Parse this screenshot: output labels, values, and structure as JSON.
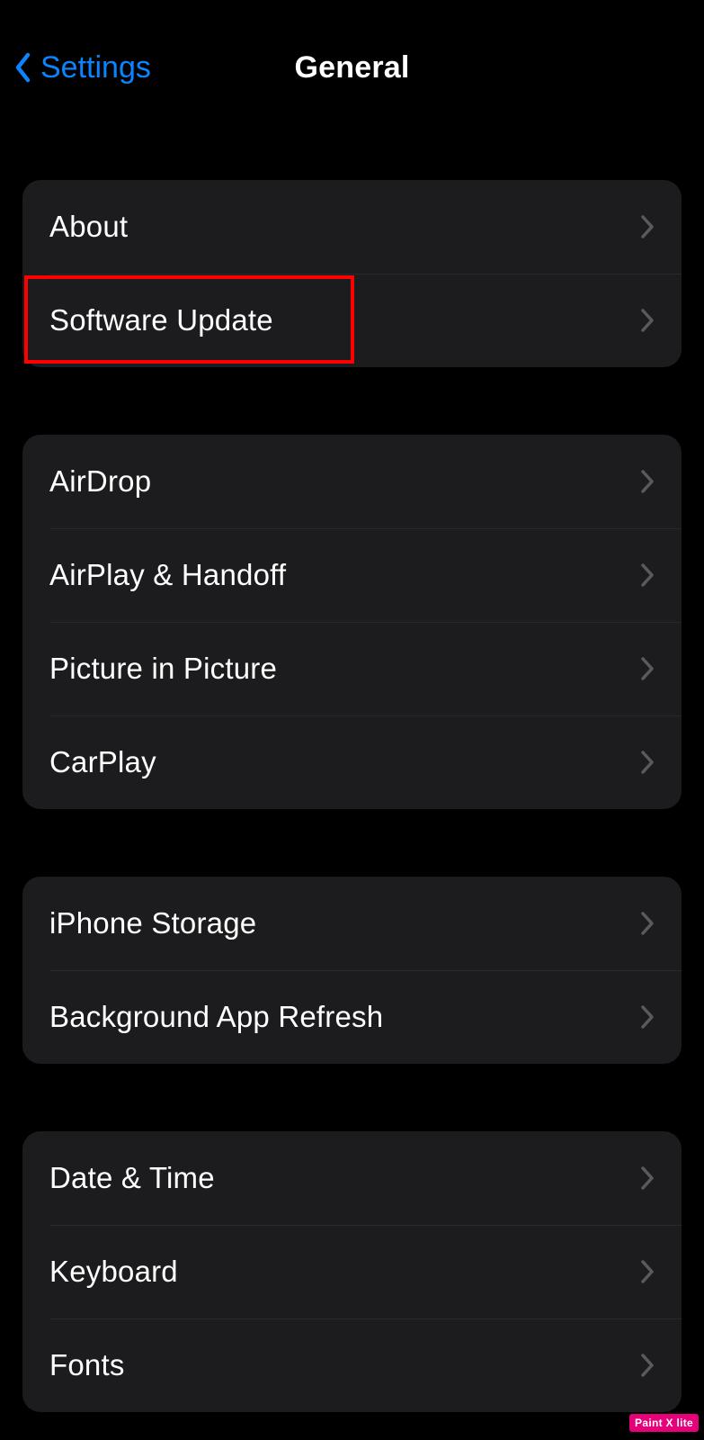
{
  "nav": {
    "back_label": "Settings",
    "title": "General"
  },
  "groups": [
    {
      "items": [
        {
          "id": "about",
          "label": "About"
        },
        {
          "id": "software-update",
          "label": "Software Update"
        }
      ]
    },
    {
      "items": [
        {
          "id": "airdrop",
          "label": "AirDrop"
        },
        {
          "id": "airplay-handoff",
          "label": "AirPlay & Handoff"
        },
        {
          "id": "picture-in-picture",
          "label": "Picture in Picture"
        },
        {
          "id": "carplay",
          "label": "CarPlay"
        }
      ]
    },
    {
      "items": [
        {
          "id": "iphone-storage",
          "label": "iPhone Storage"
        },
        {
          "id": "background-app-refresh",
          "label": "Background App Refresh"
        }
      ]
    },
    {
      "items": [
        {
          "id": "date-time",
          "label": "Date & Time"
        },
        {
          "id": "keyboard",
          "label": "Keyboard"
        },
        {
          "id": "fonts",
          "label": "Fonts"
        }
      ]
    }
  ],
  "highlight": {
    "target_id": "software-update",
    "color": "#ff0000"
  },
  "watermark": "Paint X lite",
  "colors": {
    "accent": "#0a84ff",
    "row_bg": "#1c1c1e",
    "chevron": "#5a5a5e"
  }
}
